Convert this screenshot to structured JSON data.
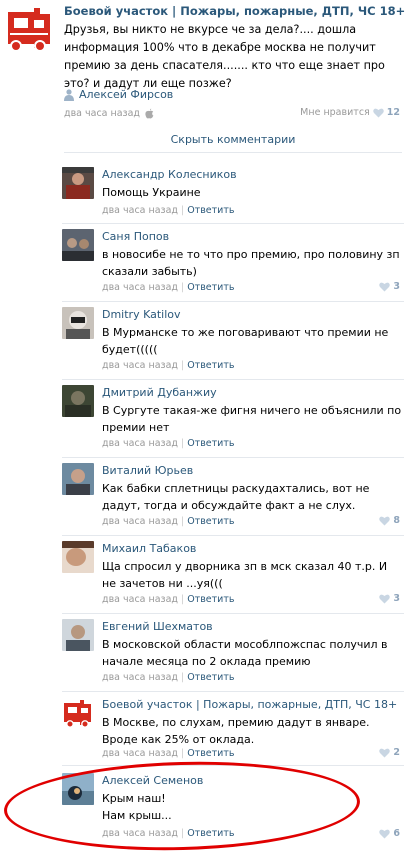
{
  "post": {
    "title": "Боевой участок | Пожары, пожарные, ДТП, ЧС 18+",
    "text": "Друзья, вы никто не вкурсе че за дела?.... дошла информация 100% что в декабре москва не получит премию за день спасателя....... кто что еще знает про это? и дадут ли еще позже?",
    "signer": "Алексей Фирсов",
    "time": "два часа назад",
    "like_label": "Мне нравится",
    "like_count": "12"
  },
  "hide_comments": "Скрыть комментарии",
  "reply_label": "Ответить",
  "comments": [
    {
      "author": "Александр Колесников",
      "text": "Помощь Украине",
      "time": "два часа назад",
      "likes": ""
    },
    {
      "author": "Саня Попов",
      "text": "в новосибе не то что про премию, про половину зп сказали забыть)",
      "time": "два часа назад",
      "likes": "3"
    },
    {
      "author": "Dmitry Katilov",
      "text": "В Мурманске то же поговаривают что премии не будет(((((",
      "time": "два часа назад",
      "likes": ""
    },
    {
      "author": "Дмитрий Дубанжиу",
      "text": "В Сургуте такая-же фигня ничего не объяснили по премии нет",
      "time": "два часа назад",
      "likes": ""
    },
    {
      "author": "Виталий Юрьев",
      "text": "Как бабки сплетницы раскудахтались, вот не дадут, тогда и обсуждайте факт а не слух.",
      "time": "два часа назад",
      "likes": "8"
    },
    {
      "author": "Михаил Табаков",
      "text": "Ща спросил у дворника зп в мск сказал 40 т.р. И не зачетов ни ...уя(((",
      "time": "два часа назад",
      "likes": "3"
    },
    {
      "author": "Евгений Шехматов",
      "text": "В московской области мособлпожспас получил в начале месяца по 2 оклада премию",
      "time": "два часа назад",
      "likes": ""
    },
    {
      "author": "Боевой участок | Пожары, пожарные, ДТП, ЧС 18+",
      "text": "В Москве, по слухам, премию дадут в январе. Вроде как 25% от оклада.",
      "time": "два часа назад",
      "likes": "2"
    },
    {
      "author": "Алексей Семенов",
      "text": "Крым наш!\nНам крыш...",
      "time": "два часа назад",
      "likes": "6"
    }
  ],
  "colors": {
    "link": "#2b587a",
    "meta": "#999999",
    "highlight_ellipse": "#e00000",
    "logo_red": "#d52b1e"
  }
}
